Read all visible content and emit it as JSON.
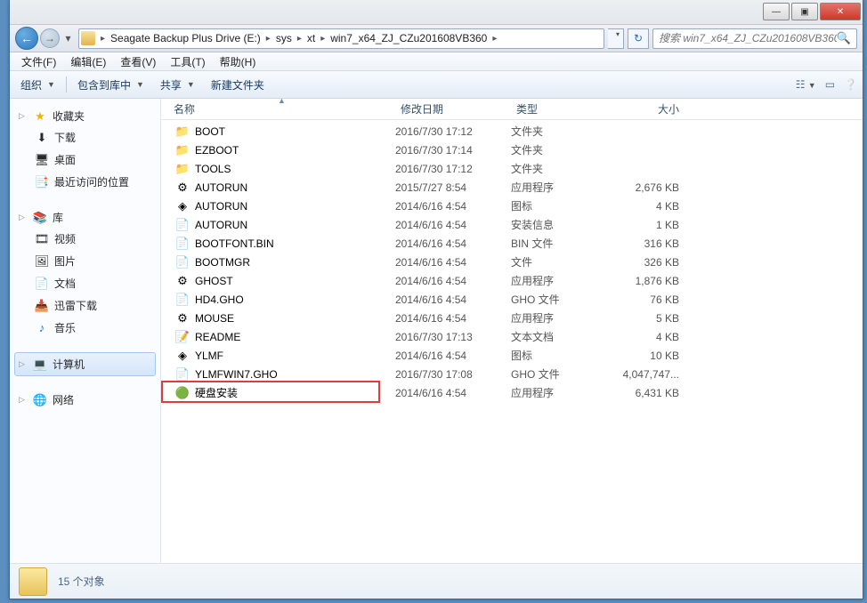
{
  "titlebar": {
    "min": "—",
    "max": "▣",
    "close": "✕"
  },
  "breadcrumbs": {
    "segments": [
      "Seagate Backup Plus Drive (E:)",
      "sys",
      "xt",
      "win7_x64_ZJ_CZu201608VB360"
    ]
  },
  "search": {
    "placeholder": "搜索 win7_x64_ZJ_CZu201608VB360"
  },
  "menubar": {
    "items": [
      "文件(F)",
      "编辑(E)",
      "查看(V)",
      "工具(T)",
      "帮助(H)"
    ]
  },
  "toolbar": {
    "organize": "组织",
    "include": "包含到库中",
    "share": "共享",
    "newfolder": "新建文件夹"
  },
  "sidebar": {
    "favorites": {
      "head": "收藏夹",
      "items": [
        {
          "icon": "download-icon",
          "label": "下载"
        },
        {
          "icon": "desktop-icon",
          "label": "桌面"
        },
        {
          "icon": "recent-icon",
          "label": "最近访问的位置"
        }
      ]
    },
    "libraries": {
      "head": "库",
      "items": [
        {
          "icon": "video-icon",
          "label": "视频"
        },
        {
          "icon": "pictures-icon",
          "label": "图片"
        },
        {
          "icon": "documents-icon",
          "label": "文档"
        },
        {
          "icon": "xunlei-icon",
          "label": "迅雷下载"
        },
        {
          "icon": "music-icon",
          "label": "音乐"
        }
      ]
    },
    "computer": {
      "head": "计算机",
      "selected": true
    },
    "network": {
      "head": "网络"
    }
  },
  "columns": {
    "name": "名称",
    "date": "修改日期",
    "type": "类型",
    "size": "大小"
  },
  "files": [
    {
      "icon": "folder",
      "name": "BOOT",
      "date": "2016/7/30 17:12",
      "type": "文件夹",
      "size": ""
    },
    {
      "icon": "folder",
      "name": "EZBOOT",
      "date": "2016/7/30 17:14",
      "type": "文件夹",
      "size": ""
    },
    {
      "icon": "folder",
      "name": "TOOLS",
      "date": "2016/7/30 17:12",
      "type": "文件夹",
      "size": ""
    },
    {
      "icon": "exe",
      "name": "AUTORUN",
      "date": "2015/7/27 8:54",
      "type": "应用程序",
      "size": "2,676 KB"
    },
    {
      "icon": "ico",
      "name": "AUTORUN",
      "date": "2014/6/16 4:54",
      "type": "图标",
      "size": "4 KB"
    },
    {
      "icon": "inf",
      "name": "AUTORUN",
      "date": "2014/6/16 4:54",
      "type": "安装信息",
      "size": "1 KB"
    },
    {
      "icon": "file",
      "name": "BOOTFONT.BIN",
      "date": "2014/6/16 4:54",
      "type": "BIN 文件",
      "size": "316 KB"
    },
    {
      "icon": "file",
      "name": "BOOTMGR",
      "date": "2014/6/16 4:54",
      "type": "文件",
      "size": "326 KB"
    },
    {
      "icon": "exe",
      "name": "GHOST",
      "date": "2014/6/16 4:54",
      "type": "应用程序",
      "size": "1,876 KB"
    },
    {
      "icon": "file",
      "name": "HD4.GHO",
      "date": "2014/6/16 4:54",
      "type": "GHO 文件",
      "size": "76 KB"
    },
    {
      "icon": "exe",
      "name": "MOUSE",
      "date": "2014/6/16 4:54",
      "type": "应用程序",
      "size": "5 KB"
    },
    {
      "icon": "txt",
      "name": "README",
      "date": "2016/7/30 17:13",
      "type": "文本文档",
      "size": "4 KB"
    },
    {
      "icon": "ico",
      "name": "YLMF",
      "date": "2014/6/16 4:54",
      "type": "图标",
      "size": "10 KB"
    },
    {
      "icon": "file",
      "name": "YLMFWIN7.GHO",
      "date": "2016/7/30 17:08",
      "type": "GHO 文件",
      "size": "4,047,747..."
    },
    {
      "icon": "app",
      "name": "硬盘安装",
      "date": "2014/6/16 4:54",
      "type": "应用程序",
      "size": "6,431 KB",
      "highlight": true
    }
  ],
  "statusbar": {
    "count": "15 个对象"
  },
  "icons": {
    "download-icon": "⬇",
    "desktop-icon": "🖥",
    "recent-icon": "📑",
    "video-icon": "🎞",
    "pictures-icon": "🖼",
    "documents-icon": "📄",
    "xunlei-icon": "📥",
    "music-icon": "♪",
    "favorites-star": "★",
    "library": "📚",
    "computer": "💻",
    "network": "🌐",
    "folder": "📁",
    "exe": "⚙",
    "ico": "◈",
    "inf": "📄",
    "file": "📄",
    "txt": "📝",
    "app": "🟢"
  }
}
